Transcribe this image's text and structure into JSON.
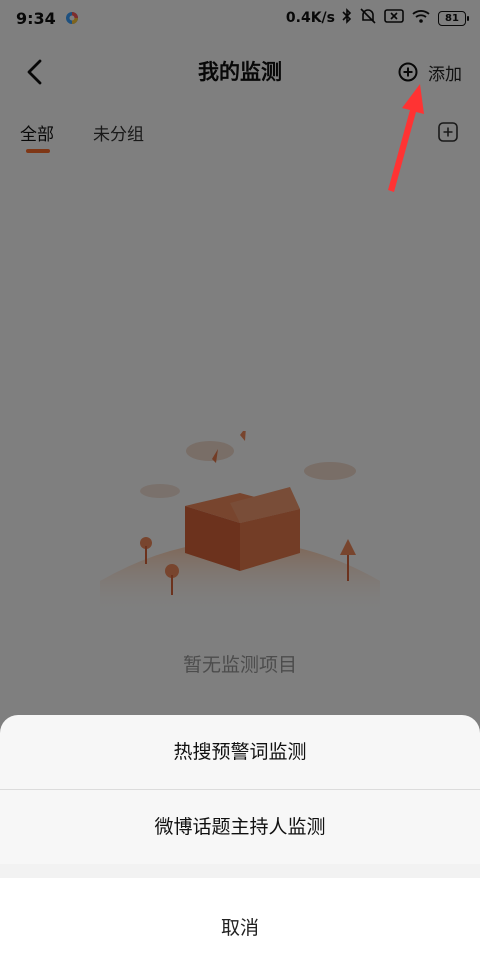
{
  "status_bar": {
    "time": "9:34",
    "network_speed": "0.4K/s",
    "battery_level": "81"
  },
  "header": {
    "back_icon": "chevron-left-icon",
    "title": "我的监测",
    "add_icon": "plus-circle-icon",
    "add_label": "添加"
  },
  "tabs": [
    {
      "label": "全部",
      "active": true
    },
    {
      "label": "未分组",
      "active": false
    }
  ],
  "group_add_icon": "plus-square-icon",
  "empty_state": {
    "illustration": "empty-box-icon",
    "text": "暂无监测项目"
  },
  "action_sheet": {
    "items": [
      {
        "label": "热搜预警词监测"
      },
      {
        "label": "微博话题主持人监测"
      }
    ],
    "cancel_label": "取消"
  },
  "colors": {
    "accent": "#ff6f2c",
    "annotation_arrow": "#ff3333",
    "overlay": "rgba(0,0,0,0.5)"
  }
}
